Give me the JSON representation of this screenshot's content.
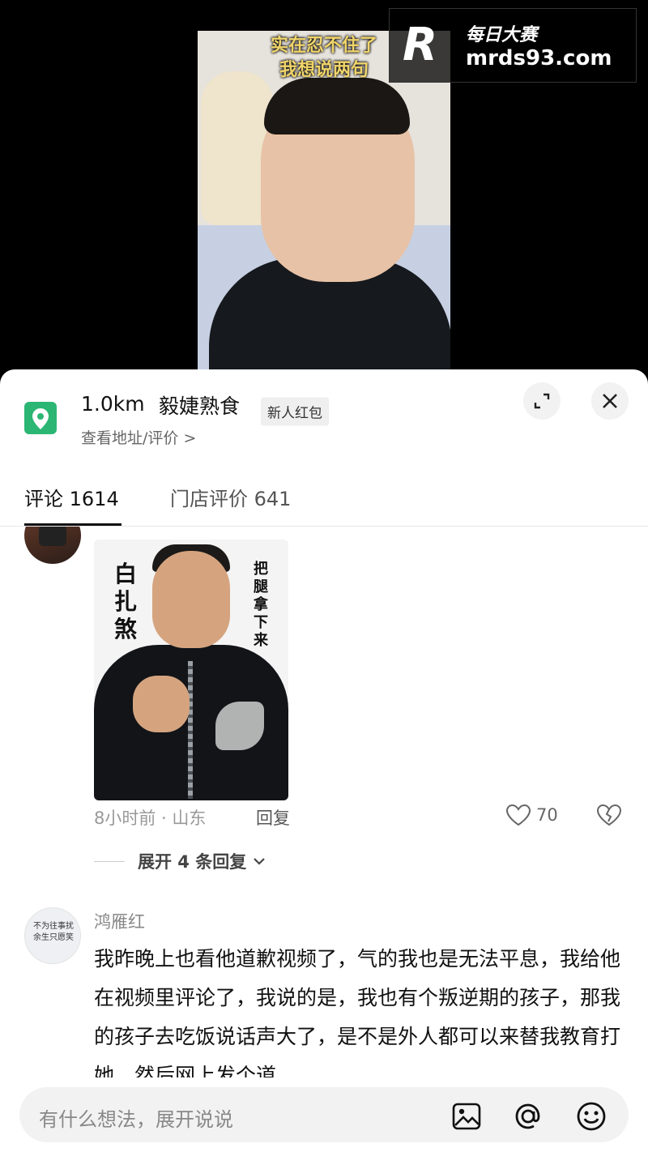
{
  "video": {
    "caption_line1": "实在忍不住了",
    "caption_line2": "我想说两句"
  },
  "watermark": {
    "logo": "R",
    "name": "每日大赛",
    "site": "mrds93.com"
  },
  "poi": {
    "distance": "1.0km",
    "name": "毅婕熟食",
    "badge": "新人红包",
    "link": "查看地址/评价 >",
    "icon": "location-pin-icon",
    "accent_color": "#2bb673"
  },
  "tabs": [
    {
      "label": "评论",
      "count": "1614"
    },
    {
      "label": "门店评价",
      "count": "641"
    }
  ],
  "comments": [
    {
      "meme_text_left": "白扎煞",
      "meme_text_right": "把腿拿下来",
      "time_location": "8小时前 · 山东",
      "reply_label": "回复",
      "likes": "70",
      "expand_label": "展开 4 条回复"
    },
    {
      "avatar_text": "不为往事扰 余生只愿笑",
      "author": "鸿雁红",
      "text": "我昨晚上也看他道歉视频了，气的我也是无法平息，我给他在视频里评论了，我说的是，我也有个叛逆期的孩子，那我的孩子去吃饭说话声大了，是不是外人都可以来替我教育打她，然后网上发个道"
    }
  ],
  "input": {
    "placeholder": "有什么想法，展开说说"
  }
}
